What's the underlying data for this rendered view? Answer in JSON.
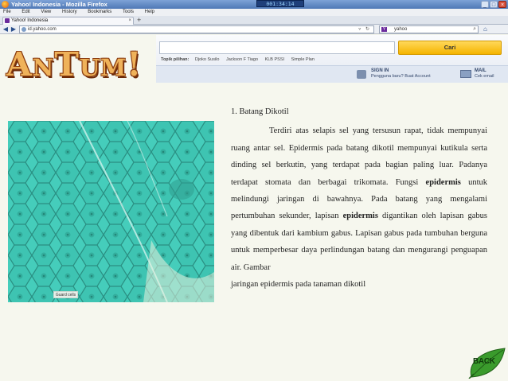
{
  "browser": {
    "window_title": "Yahoo! Indonesia - Mozilla Firefox",
    "timer": "001:34:14",
    "menu": [
      "File",
      "Edit",
      "View",
      "History",
      "Bookmarks",
      "Tools",
      "Help"
    ],
    "tab_title": "Yahoo! Indonesia",
    "new_tab": "+",
    "url": "id.yahoo.com",
    "search_value": "yahoo",
    "window_buttons": [
      "_",
      "□",
      "×"
    ]
  },
  "yahoo": {
    "search_button": "Cari",
    "topics_label": "Topik pilihan:",
    "topics": [
      "Djoko Susilo",
      "Jackson F Tiago",
      "KLB PSSI",
      "Simple Plan"
    ],
    "signin_title": "SIGN IN",
    "signin_sub": "Pengguna baru? Buat Account",
    "mail_title": "MAIL",
    "mail_sub": "Cek email"
  },
  "slide": {
    "logo": "AnTum!",
    "image_label": "Guard cells",
    "heading": "1. Batang Dikotil",
    "p1": "Terdiri atas selapis sel yang tersusun rapat, tidak mempunyai ruang antar sel. Epidermis pada batang dikotil mempunyai kutikula serta dinding sel berkutin, yang terdapat pada bagian paling luar. Padanya terdapat stomata dan berbagai trikomata. Fungsi ",
    "b1": "epidermis",
    "p2": " untuk melindungi jaringan di bawahnya. Pada batang yang mengalami pertumbuhan sekunder, lapisan ",
    "b2": "epidermis",
    "p3": " digantikan oleh lapisan gabus yang dibentuk dari kambium gabus. Lapisan gabus pada tumbuhan berguna untuk memperbesar daya perlindungan batang dan mengurangi penguapan air. Gambar",
    "last_line": "jaringan epidermis pada tanaman dikotil",
    "back_button": "BACK"
  },
  "colors": {
    "background": "#f6f7ee",
    "micrograph": "#3fcab8",
    "logo_fill": "#efb25a",
    "logo_outline": "#8a3c10",
    "leaf": "#3a9b2c"
  }
}
